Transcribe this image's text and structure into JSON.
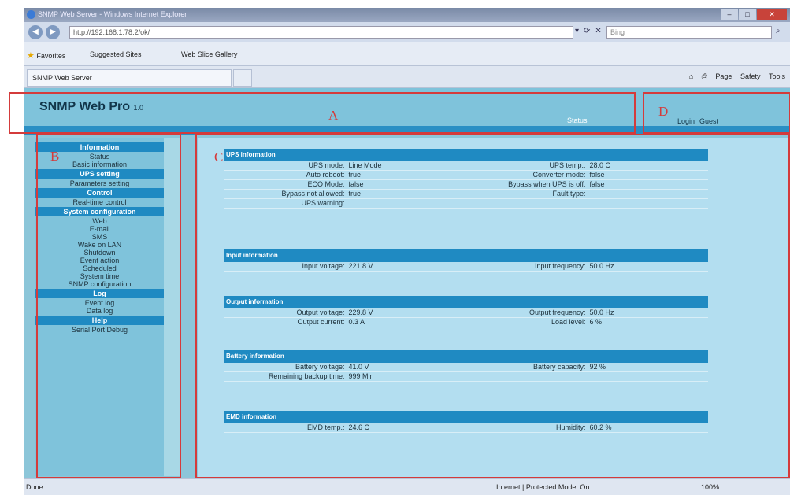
{
  "browser": {
    "title": "SNMP Web Server - Windows Internet Explorer",
    "address": "http://192.168.1.78.2/ok/",
    "search_placeholder": "Bing",
    "favorites_label": "Favorites",
    "fav_items": [
      "Suggested Sites",
      "Web Slice Gallery"
    ],
    "tab_title": "SNMP Web Server",
    "cmd_items": [
      "Page",
      "Safety",
      "Tools"
    ],
    "status_left": "Done",
    "status_zone": "Internet | Protected Mode: On",
    "zoom": "100%"
  },
  "header": {
    "product": "SNMP Web Pro",
    "version": "1.0",
    "status_link": "Status",
    "login": "Login",
    "guest": "Guest"
  },
  "regions": {
    "a": "A",
    "b": "B",
    "c": "C",
    "d": "D"
  },
  "sidebar": {
    "information": {
      "head": "Information",
      "items": [
        "Status",
        "Basic information"
      ]
    },
    "ups_setting": {
      "head": "UPS setting",
      "items": [
        "Parameters setting"
      ]
    },
    "control": {
      "head": "Control",
      "items": [
        "Real-time control"
      ]
    },
    "system": {
      "head": "System configuration",
      "items": [
        "Web",
        "E-mail",
        "SMS",
        "Wake on LAN",
        "Shutdown",
        "Event action",
        "Scheduled",
        "System time",
        "SNMP configuration"
      ]
    },
    "log": {
      "head": "Log",
      "items": [
        "Event log",
        "Data log"
      ]
    },
    "help": {
      "head": "Help",
      "items": [
        "Serial Port Debug"
      ]
    }
  },
  "ups_info": {
    "title": "UPS information",
    "rows": [
      [
        "UPS mode:",
        "Line Mode",
        "UPS temp.:",
        "28.0 C"
      ],
      [
        "Auto reboot:",
        "true",
        "Converter mode:",
        "false"
      ],
      [
        "ECO Mode:",
        "false",
        "Bypass when UPS is off:",
        "false"
      ],
      [
        "Bypass not allowed:",
        "true",
        "Fault type:",
        ""
      ],
      [
        "UPS warning:",
        "",
        "",
        ""
      ]
    ]
  },
  "input_info": {
    "title": "Input information",
    "rows": [
      [
        "Input voltage:",
        "221.8 V",
        "Input frequency:",
        "50.0 Hz"
      ]
    ]
  },
  "output_info": {
    "title": "Output information",
    "rows": [
      [
        "Output voltage:",
        "229.8 V",
        "Output frequency:",
        "50.0 Hz"
      ],
      [
        "Output current:",
        "0.3 A",
        "Load level:",
        "6 %"
      ]
    ]
  },
  "battery_info": {
    "title": "Battery information",
    "rows": [
      [
        "Battery voltage:",
        "41.0 V",
        "Battery capacity:",
        "92 %"
      ],
      [
        "Remaining backup time:",
        "999 Min",
        "",
        ""
      ]
    ]
  },
  "emd_info": {
    "title": "EMD information",
    "rows": [
      [
        "EMD temp.:",
        "24.6 C",
        "Humidity:",
        "60.2 %"
      ]
    ]
  }
}
